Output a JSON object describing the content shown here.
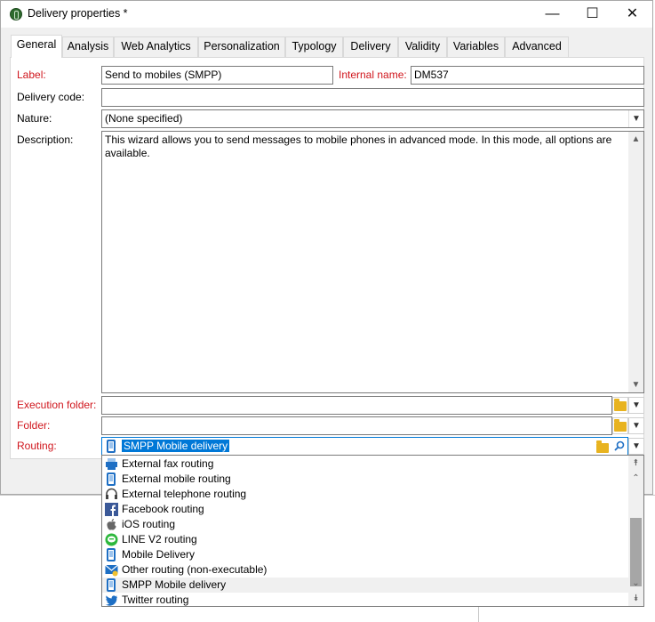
{
  "window": {
    "title": "Delivery properties *"
  },
  "window_buttons": {
    "minimize": "—",
    "maximize": "☐",
    "close": "✕"
  },
  "tabs": [
    "General",
    "Analysis",
    "Web Analytics",
    "Personalization",
    "Typology",
    "Delivery",
    "Validity",
    "Variables",
    "Advanced"
  ],
  "active_tab": "General",
  "form": {
    "label_label": "Label:",
    "label_value": "Send to mobiles (SMPP)",
    "internal_name_label": "Internal name:",
    "internal_name_value": "DM537",
    "delivery_code_label": "Delivery code:",
    "delivery_code_value": "",
    "nature_label": "Nature:",
    "nature_value": "(None specified)",
    "description_label": "Description:",
    "description_value": "This wizard allows you to send messages to mobile phones in advanced mode. In this mode, all options are available.",
    "execution_folder_label": "Execution folder:",
    "execution_folder_value": "",
    "folder_label": "Folder:",
    "folder_value": "",
    "routing_label": "Routing:",
    "routing_value": "SMPP Mobile delivery"
  },
  "routing_dropdown": {
    "items": [
      {
        "label": "External fax routing",
        "icon": "fax-icon"
      },
      {
        "label": "External mobile routing",
        "icon": "mobile-icon"
      },
      {
        "label": "External telephone routing",
        "icon": "headset-icon"
      },
      {
        "label": "Facebook routing",
        "icon": "facebook-icon"
      },
      {
        "label": "iOS routing",
        "icon": "apple-icon"
      },
      {
        "label": "LINE V2 routing",
        "icon": "line-icon"
      },
      {
        "label": "Mobile Delivery",
        "icon": "mobile-icon"
      },
      {
        "label": "Other routing (non-executable)",
        "icon": "envelope-icon"
      },
      {
        "label": "SMPP Mobile delivery",
        "icon": "mobile-icon"
      },
      {
        "label": "Twitter routing",
        "icon": "twitter-icon"
      }
    ],
    "highlighted": "SMPP Mobile delivery"
  },
  "colors": {
    "required_label": "#d0161d",
    "selection": "#0078d7",
    "folder": "#e8b31f",
    "mobile": "#1e6fc4"
  }
}
